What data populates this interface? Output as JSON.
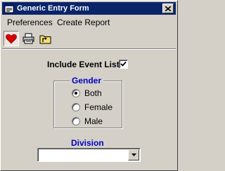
{
  "window": {
    "title": "Generic Entry Form",
    "title_icon": "form-app-icon",
    "close_icon": "close-icon"
  },
  "menu": {
    "items": [
      {
        "label": "Preferences"
      },
      {
        "label": "Create Report"
      }
    ]
  },
  "toolbar": {
    "buttons": [
      {
        "icon": "heart-icon",
        "pressed": true
      },
      {
        "icon": "printer-icon",
        "pressed": false
      },
      {
        "icon": "folder-up-icon",
        "pressed": false
      }
    ]
  },
  "form": {
    "include_event_list": {
      "label": "Include Event List",
      "checked": true
    },
    "gender": {
      "title": "Gender",
      "options": [
        {
          "label": "Both",
          "selected": true
        },
        {
          "label": "Female",
          "selected": false
        },
        {
          "label": "Male",
          "selected": false
        }
      ]
    },
    "division": {
      "label": "Division",
      "value": ""
    }
  },
  "colors": {
    "titlebar": "#0a246a",
    "group_title": "#0000c0",
    "face": "#d4d0c8",
    "heart": "#d40000"
  }
}
